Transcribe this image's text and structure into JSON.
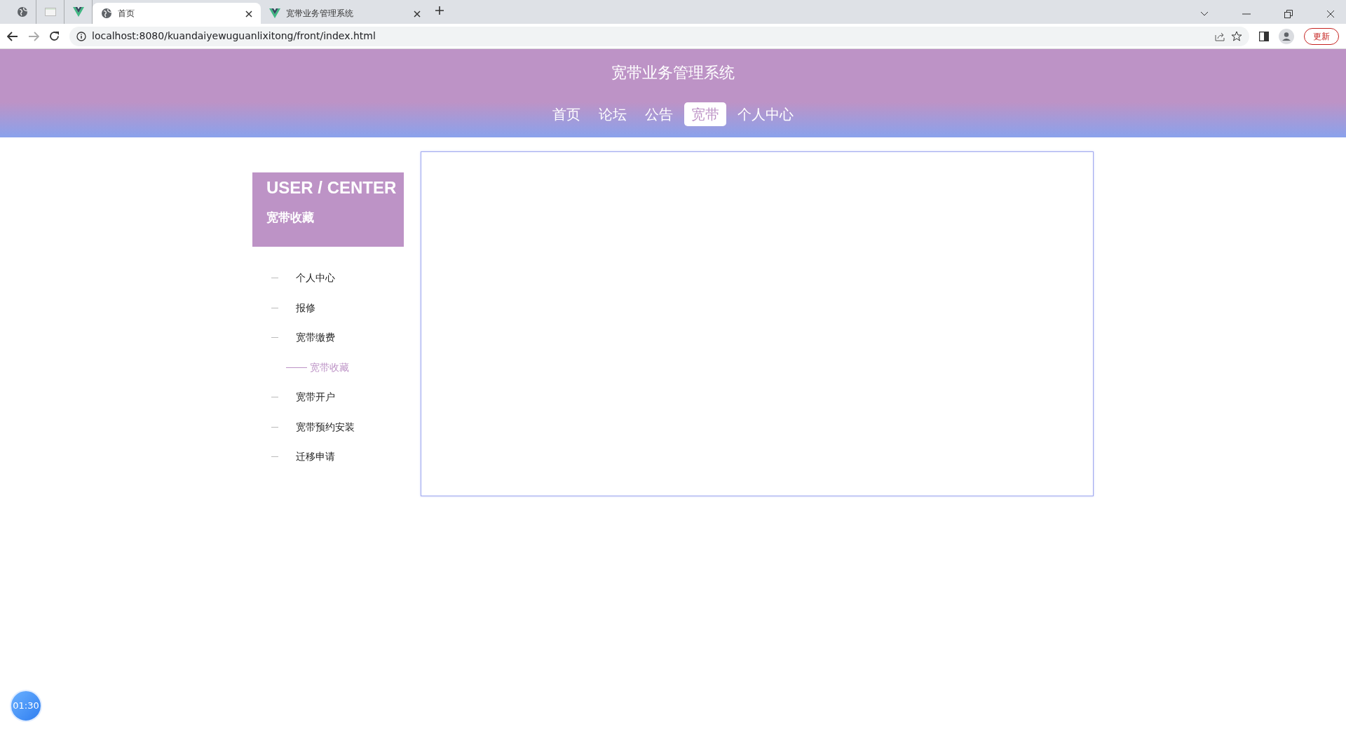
{
  "browser": {
    "tabs": [
      {
        "title": "首页",
        "selected": true,
        "kind": "globe"
      },
      {
        "title": "宽带业务管理系统",
        "selected": false,
        "kind": "vue"
      }
    ],
    "address": "localhost:8080/kuandaiyewuguanlixitong/front/index.html",
    "update_button": "更新"
  },
  "site": {
    "title": "宽带业务管理系统",
    "nav": [
      {
        "label": "首页",
        "selected": false
      },
      {
        "label": "论坛",
        "selected": false
      },
      {
        "label": "公告",
        "selected": false
      },
      {
        "label": "宽带",
        "selected": true
      },
      {
        "label": "个人中心",
        "selected": false
      }
    ]
  },
  "sidebar": {
    "heading": "USER / CENTER",
    "subtitle": "宽带收藏",
    "items": [
      {
        "label": "个人中心",
        "selected": false
      },
      {
        "label": "报修",
        "selected": false
      },
      {
        "label": "宽带缴费",
        "selected": false
      },
      {
        "label": "宽带收藏",
        "selected": true
      },
      {
        "label": "宽带开户",
        "selected": false
      },
      {
        "label": "宽带预约安装",
        "selected": false
      },
      {
        "label": "迁移申请",
        "selected": false
      }
    ]
  },
  "timer": "01:30"
}
